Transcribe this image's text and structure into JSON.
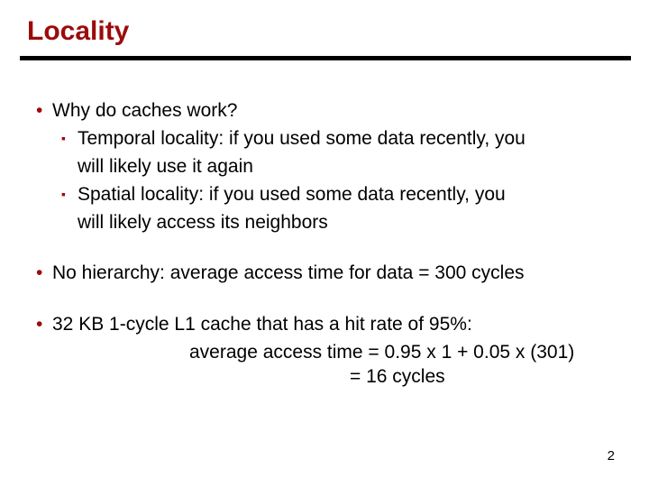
{
  "title": "Locality",
  "bullets": {
    "b1": "Why do caches work?",
    "b1a": "Temporal locality: if you used some data recently, you",
    "b1a_cont": "will likely use it again",
    "b1b": "Spatial locality: if you used some data recently, you",
    "b1b_cont": "will likely access its neighbors",
    "b2": "No hierarchy: average access time for data = 300 cycles",
    "b3": "32 KB 1-cycle L1 cache that has a hit rate of 95%:",
    "b3_calc1": "average access time = 0.95 x 1 + 0.05 x (301)",
    "b3_calc2": "= 16 cycles"
  },
  "page_number": "2"
}
